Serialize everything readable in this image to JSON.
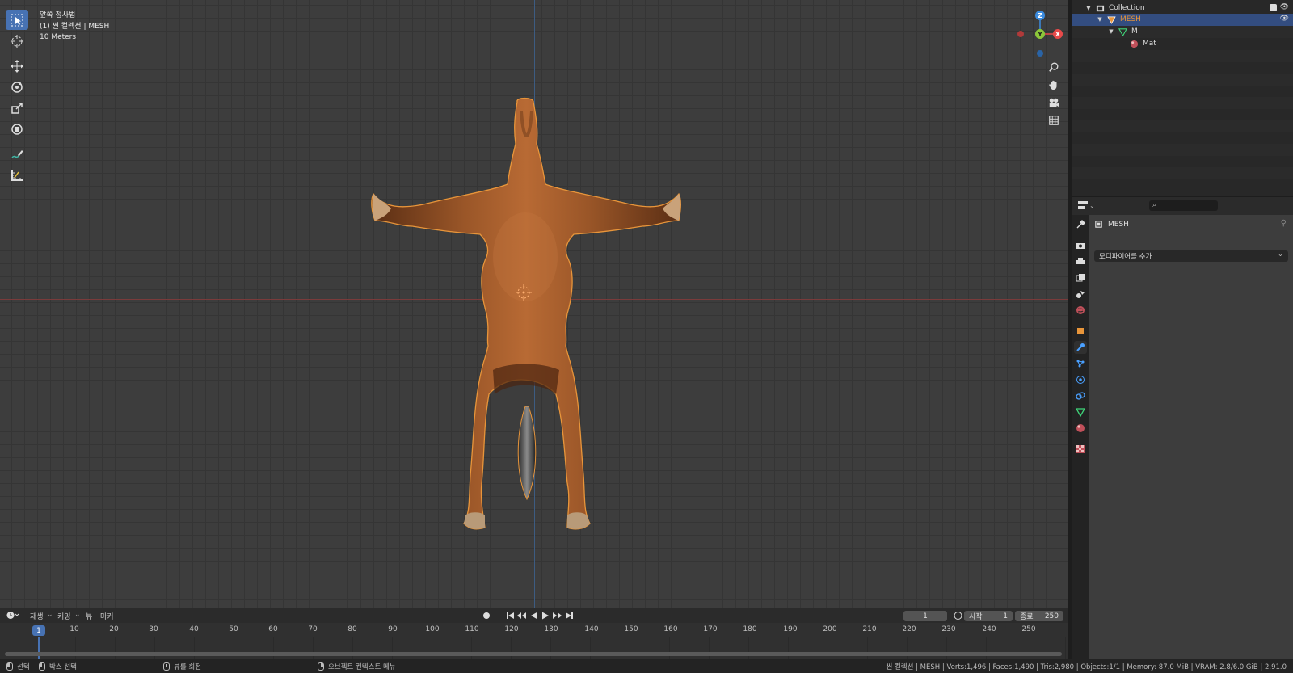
{
  "viewport": {
    "view_name": "앞쪽 정사법",
    "collection_line": "(1) 씬 컬렉션 | MESH",
    "scale": "10 Meters",
    "gizmo": {
      "z": "Z",
      "y": "Y",
      "x": "X"
    }
  },
  "timeline": {
    "menus": [
      "재생",
      "키잉",
      "뷰",
      "마커"
    ],
    "current_frame": "1",
    "start_label": "시작",
    "start": "1",
    "end_label": "종료",
    "end": "250",
    "ticks": [
      "10",
      "20",
      "30",
      "40",
      "50",
      "60",
      "70",
      "80",
      "90",
      "100",
      "110",
      "120",
      "130",
      "140",
      "150",
      "160",
      "170",
      "180",
      "190",
      "200",
      "210",
      "220",
      "230",
      "240",
      "250"
    ],
    "playhead_label": "1"
  },
  "statusbar": {
    "select": "선택",
    "box_select": "박스 선택",
    "rotate_view": "뷰를 회전",
    "context_menu": "오브젝트 컨텍스트 메뉴",
    "stats": "씬 컬렉션 | MESH | Verts:1,496 | Faces:1,490 | Tris:2,980 | Objects:1/1 | Memory: 87.0 MiB | VRAM: 2.8/6.0 GiB | 2.91.0"
  },
  "outliner": {
    "rows": [
      {
        "label": "Collection"
      },
      {
        "label": "MESH"
      },
      {
        "label": "M"
      },
      {
        "label": "Mat"
      }
    ]
  },
  "properties": {
    "object_name": "MESH",
    "add_modifier": "모디파이어를 추가"
  },
  "colors": {
    "accent": "#4772b3",
    "selection_outline": "#e8953a",
    "axis_x": "#e84a4a",
    "axis_y": "#8cc63a",
    "axis_z": "#3b8ce0"
  }
}
